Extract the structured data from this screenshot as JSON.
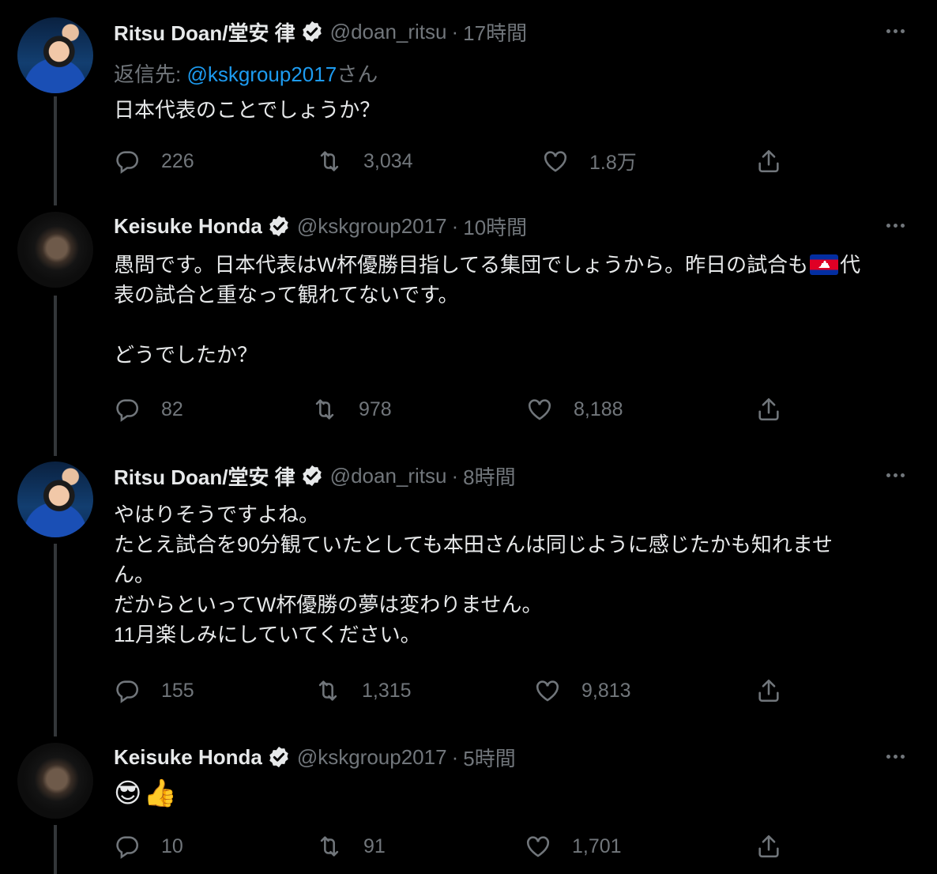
{
  "tweets": [
    {
      "author": "Ritsu Doan/堂安 律",
      "handle": "@doan_ritsu",
      "time": "17時間",
      "reply_prefix": "返信先: ",
      "reply_mention": "@kskgroup2017",
      "reply_suffix": "さん",
      "text": "日本代表のことでしょうか？",
      "replies": "226",
      "retweets": "3,034",
      "likes": "1.8万"
    },
    {
      "author": "Keisuke Honda",
      "handle": "@kskgroup2017",
      "time": "10時間",
      "text_a": "愚問です。日本代表はW杯優勝目指してる集団でしょうから。昨日の試合も",
      "text_b": "代\n表の試合と重なって観れてないです。\n\nどうでしたか？",
      "replies": "82",
      "retweets": "978",
      "likes": "8,188"
    },
    {
      "author": "Ritsu Doan/堂安 律",
      "handle": "@doan_ritsu",
      "time": "8時間",
      "text": "やはりそうですよね。\nたとえ試合を90分観ていたとしても本田さんは同じように感じたかも知れませ\nん。\nだからといってW杯優勝の夢は変わりません。\n11月楽しみにしていてください。",
      "replies": "155",
      "retweets": "1,315",
      "likes": "9,813"
    },
    {
      "author": "Keisuke Honda",
      "handle": "@kskgroup2017",
      "time": "5時間",
      "emoji": [
        "😎",
        "👍"
      ],
      "replies": "10",
      "retweets": "91",
      "likes": "1,701"
    }
  ],
  "separator": "·",
  "icons": [
    "verified-badge-icon",
    "more-icon",
    "reply-icon",
    "retweet-icon",
    "like-icon",
    "share-icon",
    "cambodia-flag-icon"
  ],
  "colors": {
    "background": "#000000",
    "text": "#e7e9ea",
    "muted": "#71767b",
    "link": "#1d9bf0",
    "thread_line": "#333639"
  }
}
